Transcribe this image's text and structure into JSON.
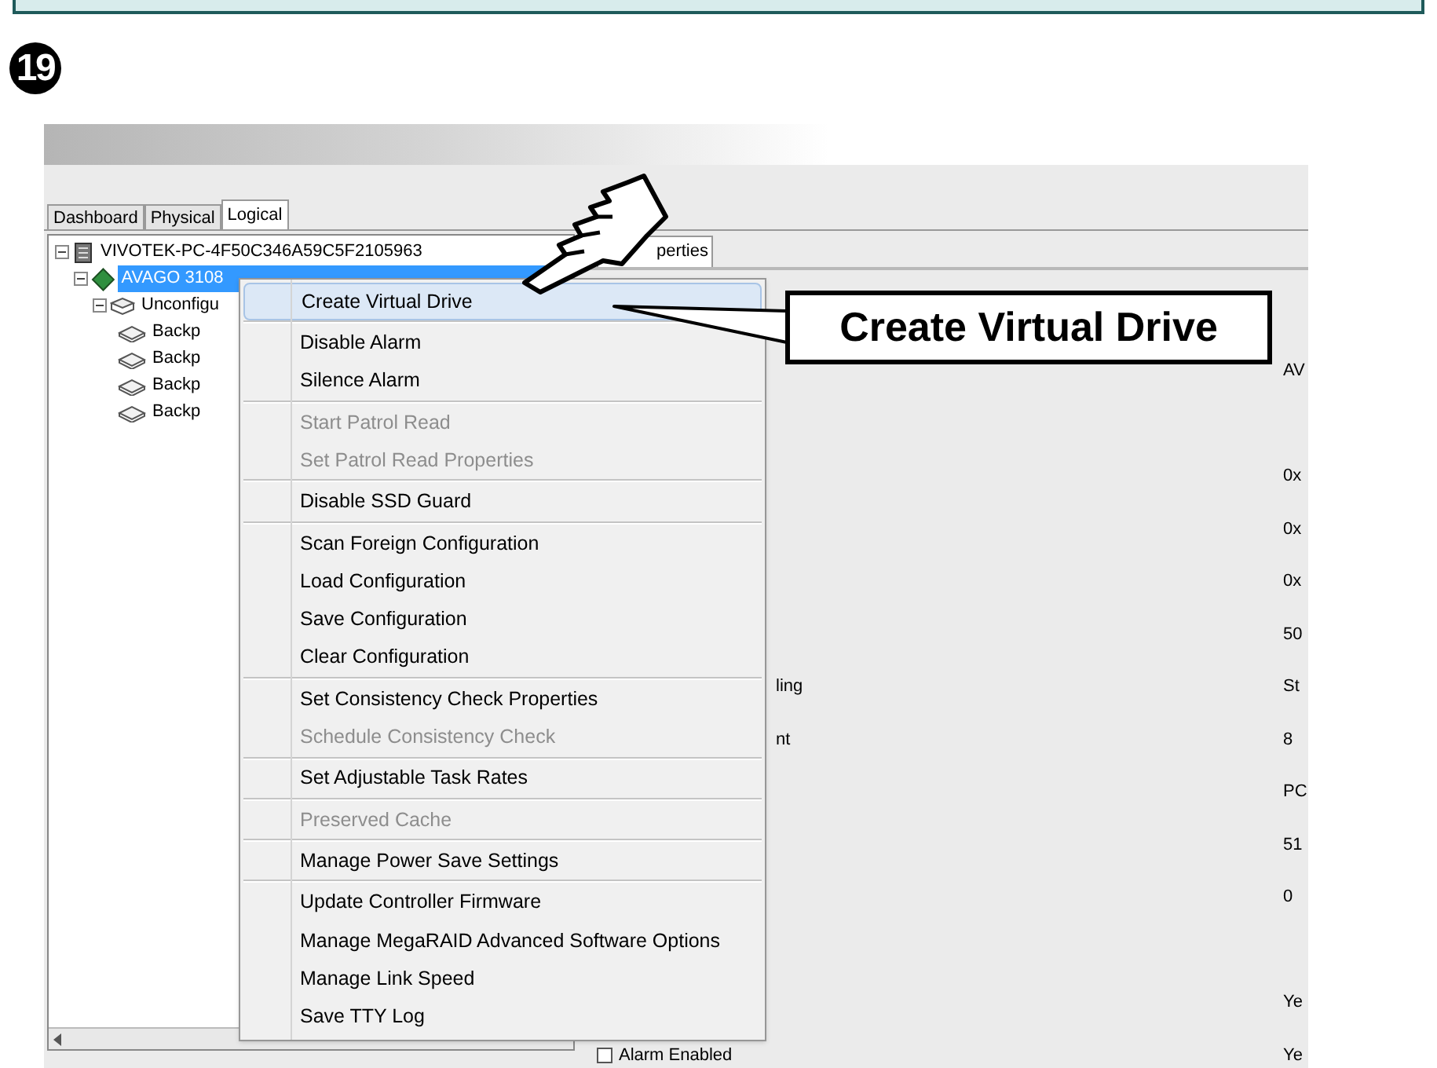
{
  "step": {
    "number": "19"
  },
  "tabs": [
    {
      "label": "Dashboard",
      "selected": false
    },
    {
      "label": "Physical",
      "selected": false
    },
    {
      "label": "Logical",
      "selected": true
    }
  ],
  "tree": {
    "label": "VIVOTEK-PC-4F50C346A59C5F2105963",
    "kind": "server",
    "expanded": true,
    "selected": false,
    "children": [
      {
        "label": "AVAGO 3108",
        "kind": "controller",
        "expanded": true,
        "selected": true,
        "children": [
          {
            "label": "Unconfigu",
            "kind": "group",
            "expanded": true,
            "selected": false,
            "children": [
              {
                "label": "Backp",
                "kind": "drive",
                "selected": false
              },
              {
                "label": "Backp",
                "kind": "drive",
                "selected": false
              },
              {
                "label": "Backp",
                "kind": "drive",
                "selected": false
              },
              {
                "label": "Backp",
                "kind": "drive",
                "selected": false
              }
            ]
          }
        ]
      }
    ]
  },
  "detail_tab": {
    "label": "perties"
  },
  "properties": [
    {
      "kind": "value",
      "value": "AV"
    },
    {
      "kind": "blank"
    },
    {
      "kind": "value",
      "value": "0x"
    },
    {
      "kind": "value",
      "value": "0x"
    },
    {
      "kind": "value",
      "value": "0x"
    },
    {
      "kind": "value",
      "value": "50"
    },
    {
      "kind": "value",
      "label": "ling",
      "value": "St"
    },
    {
      "kind": "value",
      "label": "nt",
      "value": "8"
    },
    {
      "kind": "value",
      "value": "PC"
    },
    {
      "kind": "value",
      "value": "51"
    },
    {
      "kind": "value",
      "value": "0"
    },
    {
      "kind": "blank"
    },
    {
      "kind": "value",
      "value": "Ye"
    },
    {
      "kind": "checkbox",
      "label": "Alarm Enabled",
      "checked": false,
      "value": "Ye"
    }
  ],
  "context_menu": [
    [
      {
        "label": "Create Virtual Drive",
        "disabled": false,
        "selected": true
      }
    ],
    [
      {
        "label": "Disable Alarm",
        "disabled": false,
        "selected": false
      },
      {
        "label": "Silence Alarm",
        "disabled": false,
        "selected": false
      }
    ],
    [
      {
        "label": "Start Patrol Read",
        "disabled": true,
        "selected": false
      },
      {
        "label": "Set Patrol Read Properties",
        "disabled": true,
        "selected": false
      }
    ],
    [
      {
        "label": "Disable SSD Guard",
        "disabled": false,
        "selected": false
      }
    ],
    [
      {
        "label": "Scan Foreign Configuration",
        "disabled": false,
        "selected": false
      },
      {
        "label": "Load Configuration",
        "disabled": false,
        "selected": false
      },
      {
        "label": "Save Configuration",
        "disabled": false,
        "selected": false
      },
      {
        "label": "Clear Configuration",
        "disabled": false,
        "selected": false
      }
    ],
    [
      {
        "label": "Set Consistency Check Properties",
        "disabled": false,
        "selected": false
      },
      {
        "label": "Schedule Consistency Check",
        "disabled": true,
        "selected": false
      }
    ],
    [
      {
        "label": "Set Adjustable Task Rates",
        "disabled": false,
        "selected": false
      }
    ],
    [
      {
        "label": "Preserved Cache",
        "disabled": true,
        "selected": false
      }
    ],
    [
      {
        "label": "Manage Power Save Settings",
        "disabled": false,
        "selected": false
      }
    ],
    [
      {
        "label": "Update Controller Firmware",
        "disabled": false,
        "selected": false
      },
      {
        "label": "Manage MegaRAID Advanced Software Options",
        "disabled": false,
        "selected": false
      },
      {
        "label": "Manage Link Speed",
        "disabled": false,
        "selected": false
      },
      {
        "label": "Save TTY Log",
        "disabled": false,
        "selected": false
      }
    ]
  ],
  "callout": {
    "text": "Create Virtual Drive"
  }
}
